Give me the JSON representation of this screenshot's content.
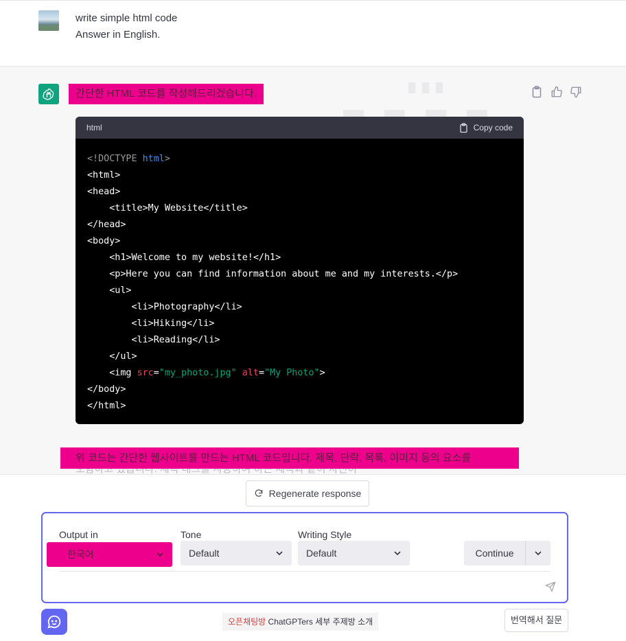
{
  "user_message": {
    "lines": [
      "write simple html code",
      "Answer in English."
    ]
  },
  "assistant_message": {
    "intro": "간단한 HTML 코드를 작성해드리겠습니다.",
    "code_block": {
      "language": "html",
      "copy_label": "Copy code",
      "lines": [
        "<!DOCTYPE html>",
        "<html>",
        "<head>",
        "    <title>My Website</title>",
        "</head>",
        "<body>",
        "    <h1>Welcome to my website!</h1>",
        "    <p>Here you can find information about me and my interests.</p>",
        "    <ul>",
        "        <li>Photography</li>",
        "        <li>Hiking</li>",
        "        <li>Reading</li>",
        "    </ul>",
        "    <img src=\"my_photo.jpg\" alt=\"My Photo\">",
        "</body>",
        "</html>"
      ]
    },
    "explanation": "위 코드는 간단한 웹사이트를 만드는 HTML 코드입니다. 제목, 단락, 목록, 이미지 등의 요소를",
    "explanation_partial": "포함하고 있습니다. 제목 태그를 사용하여                                     하는 제목과 같이 사진이"
  },
  "icons": {
    "copy": "clipboard-icon",
    "thumbs_up": "thumbs-up-icon",
    "thumbs_down": "thumbs-down-icon",
    "regenerate": "refresh-icon",
    "send": "send-icon"
  },
  "controls": {
    "regenerate_label": "Regenerate response",
    "output_label": "Output in",
    "output_value": "한국어",
    "tone_label": "Tone",
    "tone_value": "Default",
    "style_label": "Writing Style",
    "style_value": "Default",
    "continue_label": "Continue"
  },
  "footer": {
    "notice_highlight": "오픈채팅방",
    "notice_text": "ChatGPTers 세부 주제방 소개",
    "translate_label": "번역해서 질문"
  },
  "colors": {
    "highlight": "#ec008c",
    "gpt_green": "#10a37f",
    "accent": "#6366f1",
    "code_bg": "#000000"
  }
}
